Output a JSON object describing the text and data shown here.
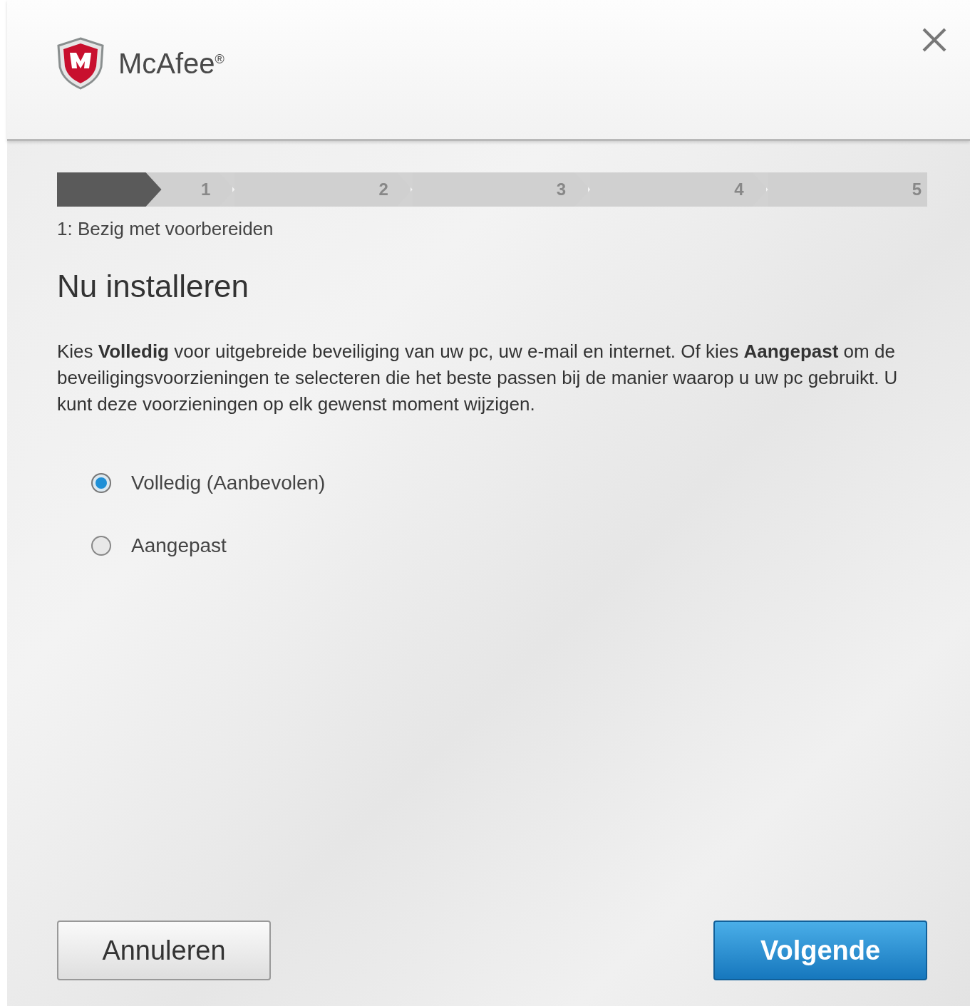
{
  "brand": {
    "name": "McAfee$^{®}$"
  },
  "progress": {
    "level": 0.12,
    "steps": [
      "1",
      "2",
      "3",
      "4",
      "5"
    ]
  },
  "step_caption": "1: Bezig met voorbereiden",
  "title": "Nu installeren",
  "description": "Kies **Volledig** voor uitgebreide beveiliging van uw pc, uw e-mail en internet. Of kies **Aangepast** om de beveiligingsvoorzieningen te selecteren die het beste passen bij de manier waarop u uw pc gebruikt. U kunt deze voorzieningen op elk gewenst moment wijzigen.",
  "options": [
    {
      "label": "Volledig (Aanbevolen)",
      "selected": true
    },
    {
      "label": "Aangepast",
      "selected": false
    }
  ],
  "buttons": [
    {
      "label": "Annuleren",
      "kind": "secondary"
    },
    {
      "label": "Volgende",
      "kind": "primary"
    }
  ]
}
